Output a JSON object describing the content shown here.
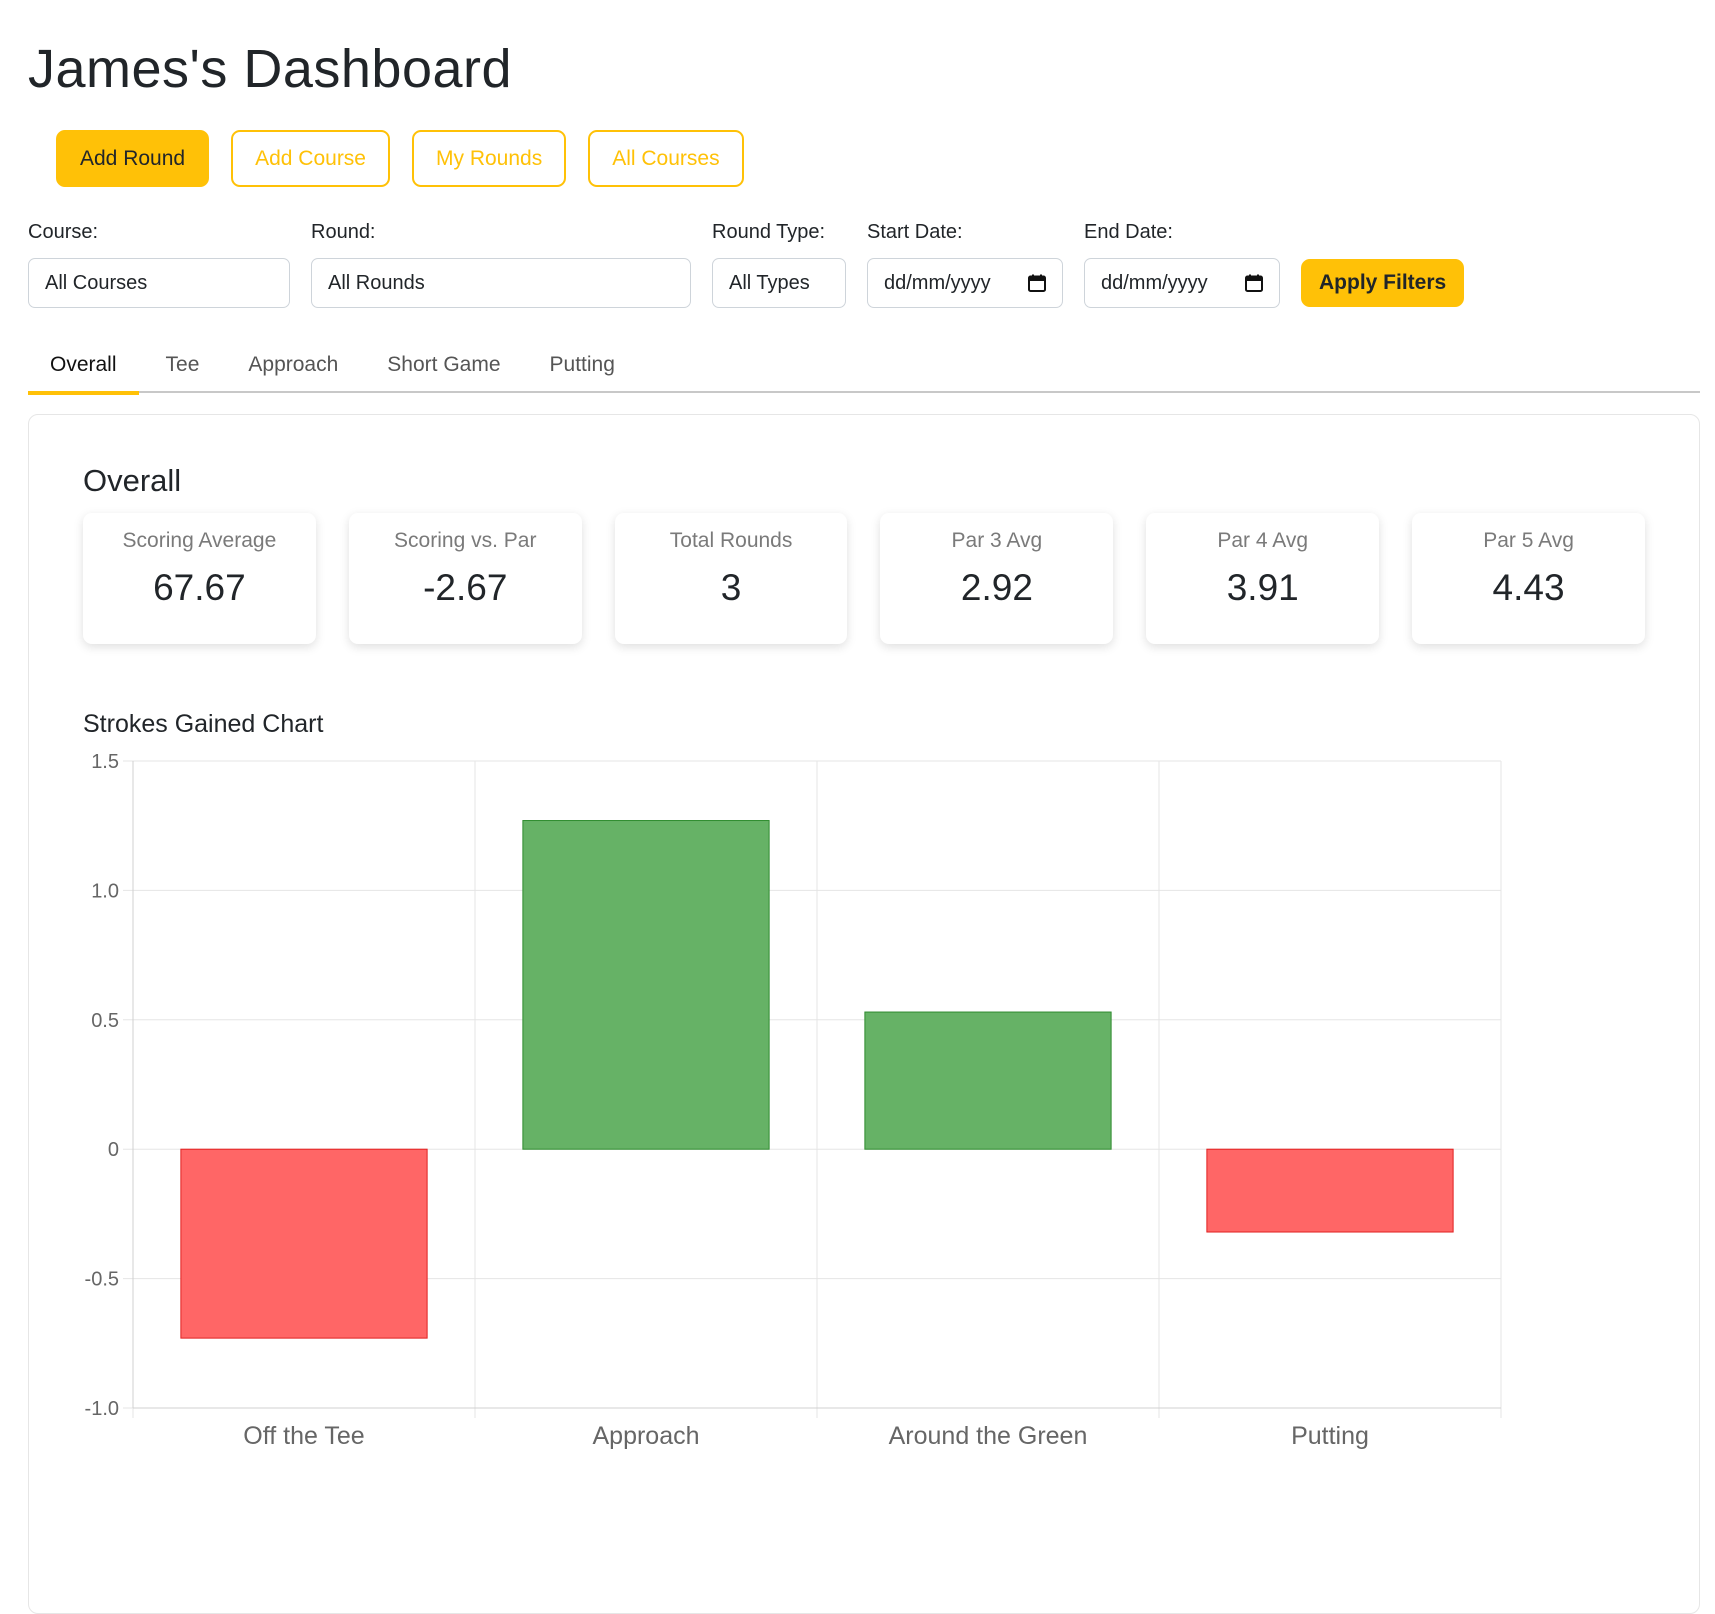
{
  "dashboard": {
    "title": "James's Dashboard"
  },
  "actions": {
    "add_round": "Add Round",
    "add_course": "Add Course",
    "my_rounds": "My Rounds",
    "all_courses": "All Courses"
  },
  "filters": {
    "course": {
      "label": "Course:",
      "value": "All Courses"
    },
    "round": {
      "label": "Round:",
      "value": "All Rounds"
    },
    "round_type": {
      "label": "Round Type:",
      "value": "All Types"
    },
    "start_date": {
      "label": "Start Date:",
      "placeholder": "dd/mm/yyyy"
    },
    "end_date": {
      "label": "End Date:",
      "placeholder": "dd/mm/yyyy"
    },
    "apply": "Apply Filters"
  },
  "tabs": [
    "Overall",
    "Tee",
    "Approach",
    "Short Game",
    "Putting"
  ],
  "active_tab": "Overall",
  "overall": {
    "title": "Overall",
    "stats": [
      {
        "label": "Scoring Average",
        "value": "67.67"
      },
      {
        "label": "Scoring vs. Par",
        "value": "-2.67"
      },
      {
        "label": "Total Rounds",
        "value": "3"
      },
      {
        "label": "Par 3 Avg",
        "value": "2.92"
      },
      {
        "label": "Par 4 Avg",
        "value": "3.91"
      },
      {
        "label": "Par 5 Avg",
        "value": "4.43"
      }
    ]
  },
  "chart_title": "Strokes Gained Chart",
  "colors": {
    "accent": "#ffc107",
    "positive_fill": "#66b266",
    "positive_stroke": "#2e8b2e",
    "negative_fill": "#ff6666",
    "negative_stroke": "#e02020"
  },
  "chart_data": {
    "type": "bar",
    "title": "",
    "categories": [
      "Off the Tee",
      "Approach",
      "Around the Green",
      "Putting"
    ],
    "values": [
      -0.73,
      1.27,
      0.53,
      -0.32
    ],
    "ylim": [
      -1.0,
      1.5
    ],
    "yticks": [
      "-1.0",
      "-0.5",
      "0",
      "0.5",
      "1.0",
      "1.5"
    ],
    "grid": true,
    "legend": "none"
  }
}
